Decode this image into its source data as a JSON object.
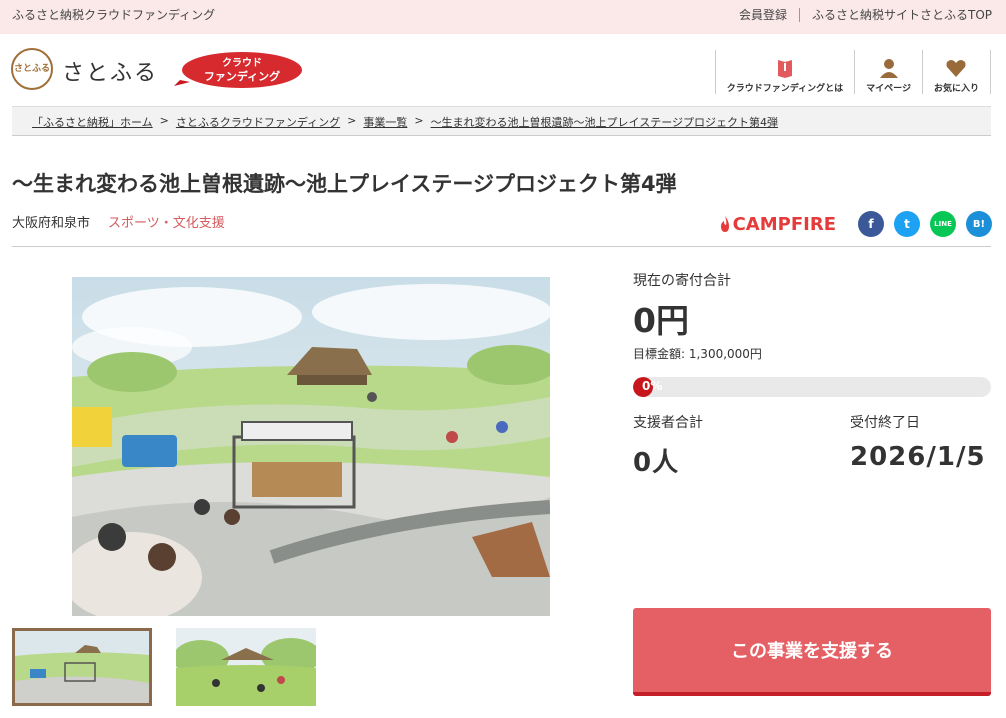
{
  "topbar": {
    "tagline": "ふるさと納税クラウドファンディング",
    "register": "会員登録",
    "site_top": "ふるさと納税サイトさとふるTOP"
  },
  "header": {
    "logo_mark": "さとふる",
    "logo_text": "さとふる",
    "cf_badge_line1": "クラウド",
    "cf_badge_line2": "ファンディング",
    "nav": [
      {
        "label": "クラウドファンディングとは",
        "icon": "book-icon"
      },
      {
        "label": "マイページ",
        "icon": "user-icon"
      },
      {
        "label": "お気に入り",
        "icon": "heart-icon"
      }
    ]
  },
  "breadcrumb": [
    "「ふるさと納税」ホーム",
    "さとふるクラウドファンディング",
    "事業一覧",
    "～生まれ変わる池上曽根遺跡～池上プレイステージプロジェクト第4弾"
  ],
  "breadcrumb_sep": ">",
  "project": {
    "title": "～生まれ変わる池上曽根遺跡～池上プレイステージプロジェクト第4弾",
    "city": "大阪府和泉市",
    "category": "スポーツ・文化支援"
  },
  "share": {
    "campfire": "CAMPFIRE",
    "sns": [
      "f",
      "t",
      "LINE",
      "B!"
    ]
  },
  "stats": {
    "current_label": "現在の寄付合計",
    "current_amount": "0円",
    "goal": "目標金額: 1,300,000円",
    "progress_text": "0%",
    "progress": 0,
    "supporters_label": "支援者合計",
    "supporters_value": "0人",
    "deadline_label": "受付終了日",
    "deadline_value": "2026/1/5"
  },
  "cta": {
    "label": "この事業を支援する"
  },
  "colors": {
    "topbar_bg": "#fbe9ea",
    "accent": "#e56065",
    "category": "#d45b5f",
    "progress": "#c8161d"
  }
}
